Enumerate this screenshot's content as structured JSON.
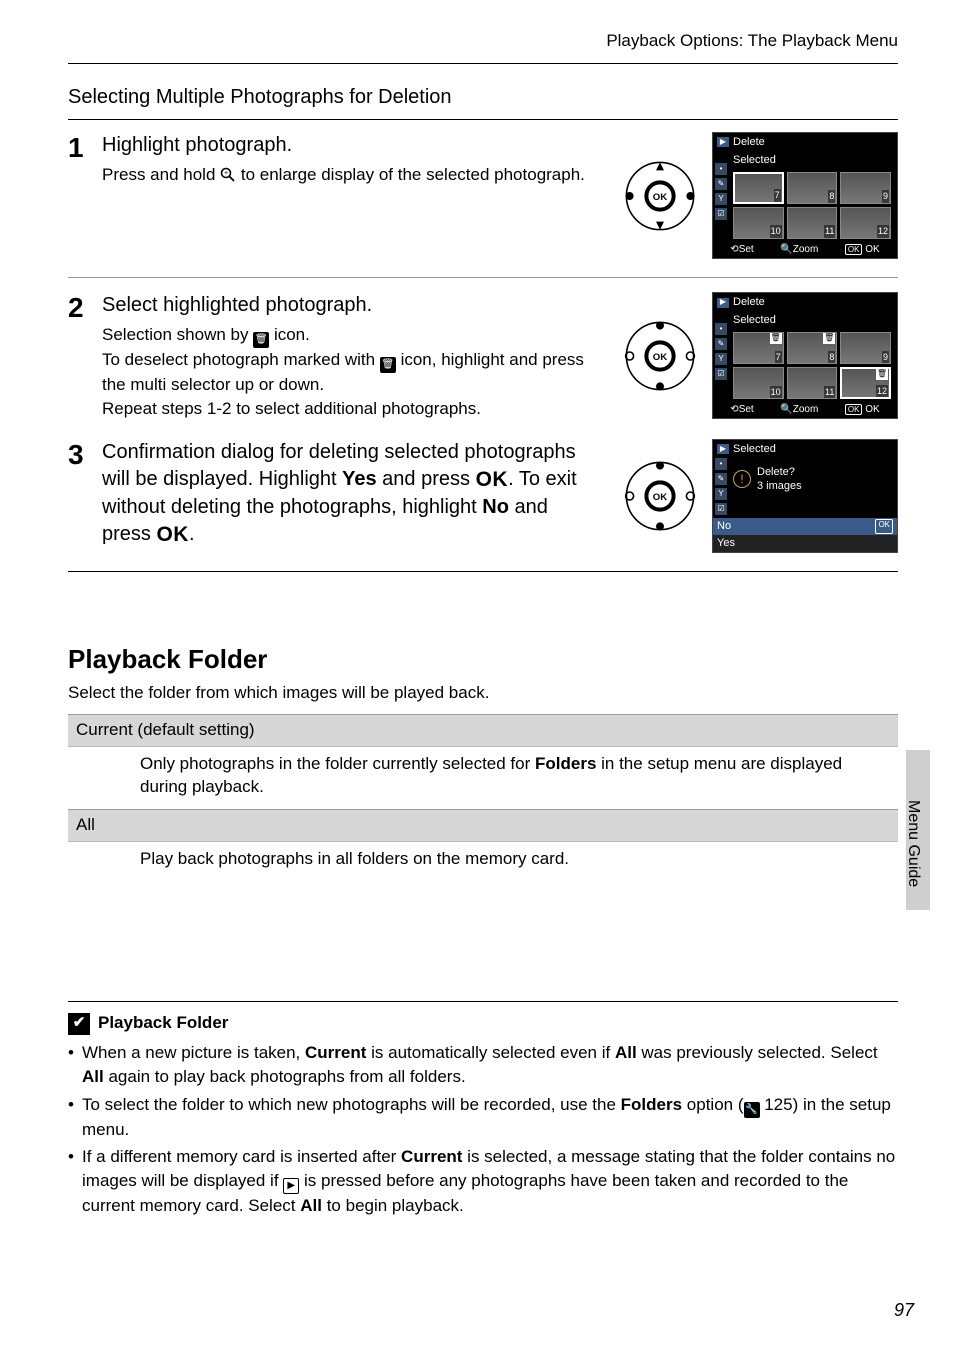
{
  "header": {
    "title": "Playback Options: The Playback Menu"
  },
  "section": {
    "subtitle": "Selecting Multiple Photographs for Deletion"
  },
  "steps": [
    {
      "num": "1",
      "title": "Highlight photograph.",
      "text_pre": "Press and hold ",
      "text_post": " to enlarge display of the selected photograph.",
      "lcd": {
        "head": "Delete",
        "sub": "Selected",
        "thumbs": [
          "7",
          "8",
          "9",
          "10",
          "11",
          "12"
        ],
        "marked": [],
        "foot": {
          "set": "Set",
          "zoom": "Zoom",
          "ok": "OK"
        }
      }
    },
    {
      "num": "2",
      "title": "Select highlighted photograph.",
      "text_lines": [
        {
          "pre": "Selection shown by ",
          "post": " icon."
        },
        {
          "pre": "To deselect photograph marked with ",
          "post": " icon, highlight and press the multi selector up or down."
        },
        {
          "plain": "Repeat steps 1-2 to select additional photographs."
        }
      ],
      "lcd": {
        "head": "Delete",
        "sub": "Selected",
        "thumbs": [
          "7",
          "8",
          "9",
          "10",
          "11",
          "12"
        ],
        "marked": [
          0,
          1,
          5
        ],
        "foot": {
          "set": "Set",
          "zoom": "Zoom",
          "ok": "OK"
        }
      }
    },
    {
      "num": "3",
      "title_parts": {
        "a": "Confirmation dialog for deleting selected photographs will be displayed. Highlight ",
        "yes": "Yes",
        "b": " and press ",
        "c": ". To exit without deleting the photographs, highlight ",
        "no": "No",
        "d": " and press ",
        "e": "."
      },
      "lcd": {
        "head": "Selected",
        "question": "Delete?",
        "count": "3  images",
        "opts": {
          "no": "No",
          "yes": "Yes"
        }
      }
    }
  ],
  "ok_label": "OK",
  "playback_folder": {
    "title": "Playback Folder",
    "intro": "Select the folder from which images will be played back.",
    "rows": [
      {
        "header": "Current (default setting)",
        "body_pre": "Only photographs in the folder currently selected for ",
        "body_bold": "Folders",
        "body_post": " in the setup menu are displayed during playback."
      },
      {
        "header": "All",
        "body_plain": "Play back photographs in all folders on the memory card."
      }
    ]
  },
  "note": {
    "title": "Playback Folder",
    "items": [
      {
        "parts": [
          {
            "t": "When a new picture is taken, "
          },
          {
            "b": "Current"
          },
          {
            "t": " is automatically selected even if "
          },
          {
            "b": "All"
          },
          {
            "t": " was previously selected. Select "
          },
          {
            "b": "All"
          },
          {
            "t": " again to play back photographs from all folders."
          }
        ]
      },
      {
        "parts": [
          {
            "t": "To select the folder to which new photographs will be recorded, use the "
          },
          {
            "b": "Folders"
          },
          {
            "t": " option ("
          },
          {
            "icon": "wrench"
          },
          {
            "t": " 125) in the setup menu."
          }
        ]
      },
      {
        "parts": [
          {
            "t": "If a different memory card is inserted after "
          },
          {
            "b": "Current"
          },
          {
            "t": " is selected, a message stating that the folder contains no images will be displayed if "
          },
          {
            "icon": "play"
          },
          {
            "t": " is pressed before any photographs have been taken and recorded to the current memory card. Select "
          },
          {
            "b": "All"
          },
          {
            "t": " to begin playback."
          }
        ]
      }
    ]
  },
  "side_label": "Menu Guide",
  "page_number": "97"
}
